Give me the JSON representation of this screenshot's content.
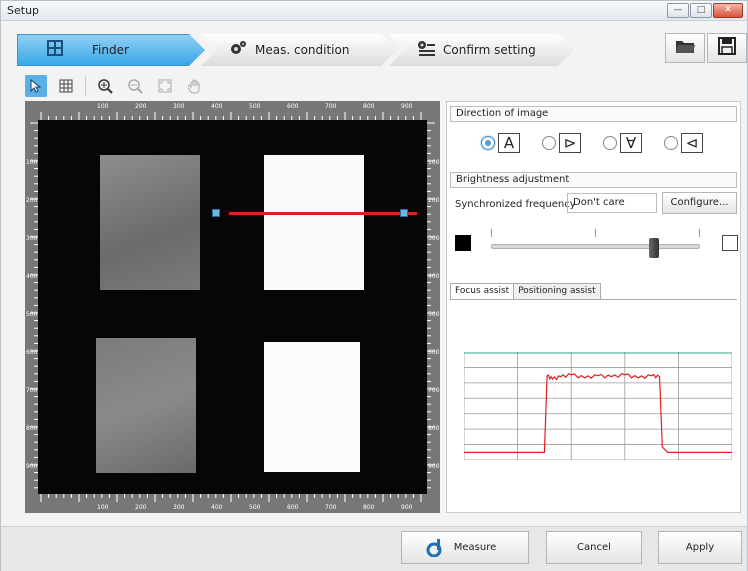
{
  "window": {
    "title": "Setup"
  },
  "window_controls": {
    "minimize": "—",
    "maximize": "□",
    "close": "✕"
  },
  "wizard": {
    "steps": [
      {
        "label": "Finder",
        "icon": "crosshair-icon",
        "active": true
      },
      {
        "label": "Meas. condition",
        "icon": "gears-icon",
        "active": false
      },
      {
        "label": "Confirm setting",
        "icon": "settings-list-icon",
        "active": false
      }
    ]
  },
  "file_buttons": {
    "open_icon": "folder-icon",
    "save_icon": "floppy-disk-icon"
  },
  "toolbar": {
    "tools": [
      {
        "name": "pointer-tool-icon",
        "active": true
      },
      {
        "name": "grid-tool-icon",
        "active": false
      },
      {
        "name": "zoom-in-icon",
        "active": false
      },
      {
        "name": "zoom-out-icon",
        "disabled": true
      },
      {
        "name": "fit-view-icon",
        "disabled": true
      },
      {
        "name": "pan-hand-icon",
        "disabled": true
      }
    ]
  },
  "viewer": {
    "ruler_top": [
      "100",
      "200",
      "300",
      "400",
      "500",
      "600",
      "700",
      "800",
      "900"
    ],
    "ruler_bottom": [
      "100",
      "200",
      "300",
      "400",
      "500",
      "600",
      "700",
      "800",
      "900"
    ],
    "ruler_left": [
      "100",
      "200",
      "300",
      "400",
      "500",
      "600",
      "700",
      "800",
      "900"
    ],
    "ruler_right": [
      "100",
      "200",
      "300",
      "400",
      "500",
      "600",
      "700",
      "800",
      "900"
    ]
  },
  "direction": {
    "title": "Direction of image",
    "options": [
      {
        "glyph": "A",
        "selected": true
      },
      {
        "glyph": "⊳",
        "selected": false
      },
      {
        "glyph": "∀",
        "selected": false
      },
      {
        "glyph": "⊲",
        "selected": false
      }
    ]
  },
  "brightness": {
    "title": "Brightness adjustment",
    "sync_label": "Synchronized frequency",
    "sync_value": "Don't care",
    "configure_label": "Configure...",
    "slider_level": 0.78
  },
  "tabs": [
    {
      "label": "Focus assist",
      "active": true
    },
    {
      "label": "Positioning assist",
      "active": false
    }
  ],
  "focus_profile": {
    "colors": {
      "profile": "#e02020",
      "baseline": "#2ca58d",
      "grid": "#9a9a9a"
    },
    "points": [
      [
        0,
        0.93
      ],
      [
        0.28,
        0.93
      ],
      [
        0.3,
        0.93
      ],
      [
        0.31,
        0.22
      ],
      [
        0.33,
        0.25
      ],
      [
        0.36,
        0.23
      ],
      [
        0.4,
        0.21
      ],
      [
        0.45,
        0.24
      ],
      [
        0.5,
        0.22
      ],
      [
        0.55,
        0.23
      ],
      [
        0.6,
        0.21
      ],
      [
        0.65,
        0.24
      ],
      [
        0.7,
        0.22
      ],
      [
        0.73,
        0.23
      ],
      [
        0.74,
        0.88
      ],
      [
        0.76,
        0.93
      ],
      [
        1,
        0.93
      ]
    ]
  },
  "bottom": {
    "measure_label": "Measure",
    "measure_icon": "measure-icon",
    "cancel_label": "Cancel",
    "apply_label": "Apply"
  }
}
